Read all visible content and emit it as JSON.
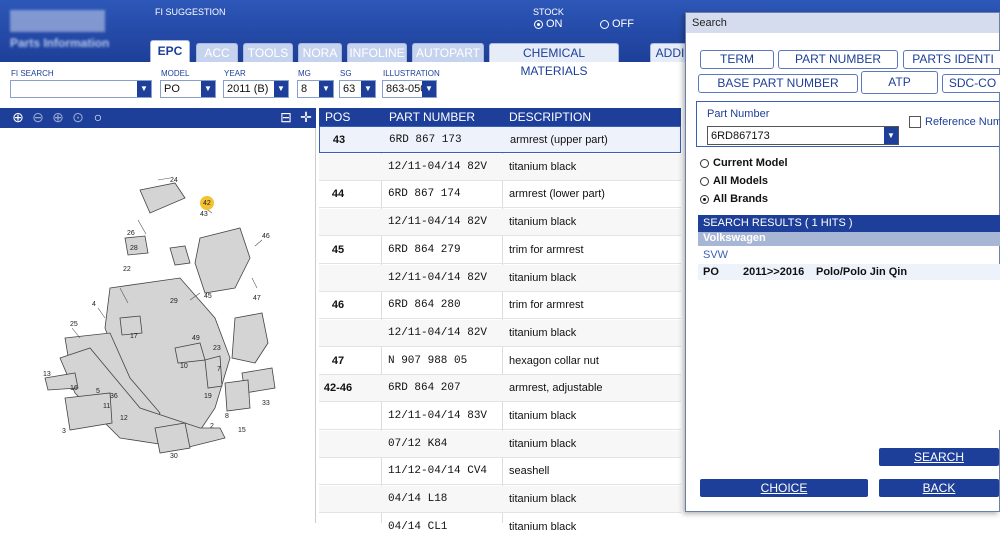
{
  "header": {
    "fi_suggestion_label": "FI SUGGESTION",
    "stock_label": "STOCK",
    "stock_on": "ON",
    "stock_off": "OFF",
    "logo_text": "Parts Information"
  },
  "tabs": [
    "EPC",
    "ACC",
    "TOOLS",
    "NORA",
    "INFOLINE",
    "AUTOPART",
    "CHEMICAL MATERIALS",
    "ADDI"
  ],
  "filters": {
    "fi_search_label": "FI SEARCH",
    "fi_search_value": "",
    "model_label": "MODEL",
    "model_value": "PO",
    "year_label": "YEAR",
    "year_value": "2011 (B)",
    "mg_label": "MG",
    "mg_value": "8",
    "sg_label": "SG",
    "sg_value": "63",
    "illustration_label": "ILLUSTRATION",
    "illustration_value": "863-050"
  },
  "table": {
    "col_pos": "POS",
    "col_part": "PART NUMBER",
    "col_desc": "DESCRIPTION",
    "rows": [
      {
        "pos": "43",
        "part": "6RD 867 173",
        "desc": "armrest (upper part)"
      },
      {
        "pos": "",
        "part": "12/11-04/14 82V",
        "desc": "titanium black"
      },
      {
        "pos": "44",
        "part": "6RD 867 174",
        "desc": "armrest (lower part)"
      },
      {
        "pos": "",
        "part": "12/11-04/14 82V",
        "desc": "titanium black"
      },
      {
        "pos": "45",
        "part": "6RD 864 279",
        "desc": "trim for armrest"
      },
      {
        "pos": "",
        "part": "12/11-04/14 82V",
        "desc": "titanium black"
      },
      {
        "pos": "46",
        "part": "6RD 864 280",
        "desc": "trim for armrest"
      },
      {
        "pos": "",
        "part": "12/11-04/14 82V",
        "desc": "titanium black"
      },
      {
        "pos": "47",
        "part": "N   907 988 05",
        "desc": "hexagon collar nut"
      },
      {
        "pos": "42-46",
        "part": "6RD 864 207",
        "desc": "armrest, adjustable"
      },
      {
        "pos": "",
        "part": "12/11-04/14 83V",
        "desc": "titanium black"
      },
      {
        "pos": "",
        "part": "07/12       K84",
        "desc": "titanium black"
      },
      {
        "pos": "",
        "part": "11/12-04/14 CV4",
        "desc": "seashell"
      },
      {
        "pos": "",
        "part": "04/14       L18",
        "desc": "titanium black"
      },
      {
        "pos": "",
        "part": "04/14       CL1",
        "desc": "titanium black"
      }
    ]
  },
  "dialog": {
    "title": "Search",
    "tabs_row1": [
      "TERM",
      "PART NUMBER",
      "PARTS IDENTI"
    ],
    "tabs_row2": [
      "BASE PART NUMBER",
      "ATP",
      "SDC-CO"
    ],
    "part_number_label": "Part Number",
    "part_number_value": "6RD867173",
    "reference_label": "Reference Num",
    "radio_current": "Current Model",
    "radio_all_models": "All Models",
    "radio_all_brands": "All Brands",
    "results_header": "SEARCH RESULTS  ( 1 HITS )",
    "brand": "Volkswagen",
    "sub_brand": "SVW",
    "result": {
      "model": "PO",
      "years": "2011>>2016",
      "name": "Polo/Polo Jin Qin"
    },
    "search_button": "SEARCH",
    "choice_button": "CHOICE",
    "back_button": "BACK"
  },
  "diagram_callouts": [
    "24",
    "42",
    "43",
    "26",
    "28",
    "22",
    "46",
    "45",
    "47",
    "29",
    "17",
    "4",
    "25",
    "5",
    "49",
    "10",
    "23",
    "7",
    "33",
    "13",
    "16",
    "12",
    "8",
    "15",
    "3",
    "19",
    "30",
    "36",
    "11",
    "2"
  ],
  "colors": {
    "brand_blue": "#1d3f99",
    "highlight": "#f2c230"
  }
}
